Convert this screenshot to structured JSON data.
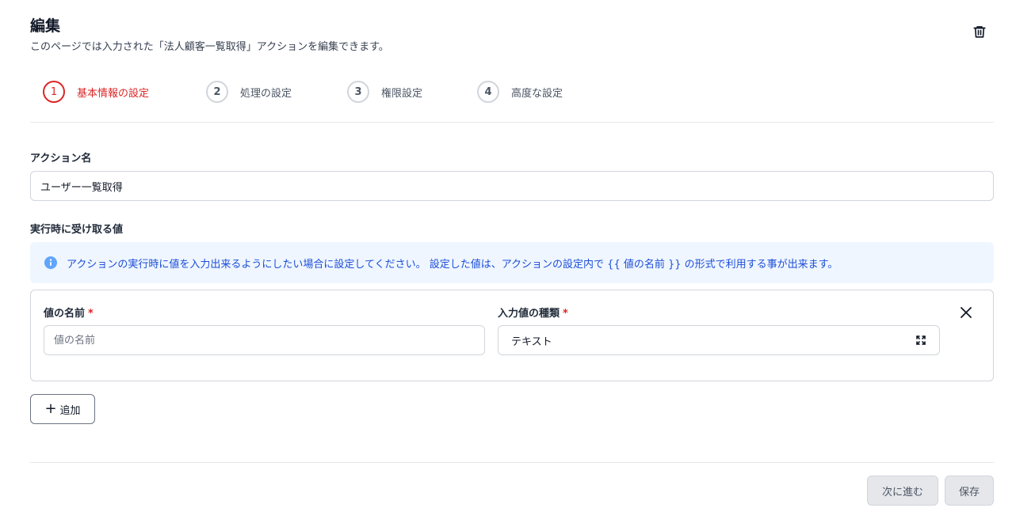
{
  "header": {
    "title": "編集",
    "description": "このページでは入力された「法人顧客一覧取得」アクションを編集できます。"
  },
  "steps": [
    {
      "number": "1",
      "label": "基本情報の設定",
      "active": true
    },
    {
      "number": "2",
      "label": "処理の設定",
      "active": false
    },
    {
      "number": "3",
      "label": "権限設定",
      "active": false
    },
    {
      "number": "4",
      "label": "高度な設定",
      "active": false
    }
  ],
  "action_name": {
    "label": "アクション名",
    "value": "ユーザー一覧取得"
  },
  "runtime_values": {
    "label": "実行時に受け取る値",
    "info": "アクションの実行時に値を入力出来るようにしたい場合に設定してください。 設定した値は、アクションの設定内で {{ 値の名前 }} の形式で利用する事が出来ます。",
    "param": {
      "name_label": "値の名前",
      "name_placeholder": "値の名前",
      "name_value": "",
      "type_label": "入力値の種類",
      "type_value": "テキスト",
      "required_mark": "*"
    },
    "add_label": "追加"
  },
  "footer": {
    "next_label": "次に進む",
    "save_label": "保存"
  },
  "colors": {
    "accent": "#dc2626",
    "info_bg": "#eff6ff",
    "info_text": "#1d4ed8"
  }
}
